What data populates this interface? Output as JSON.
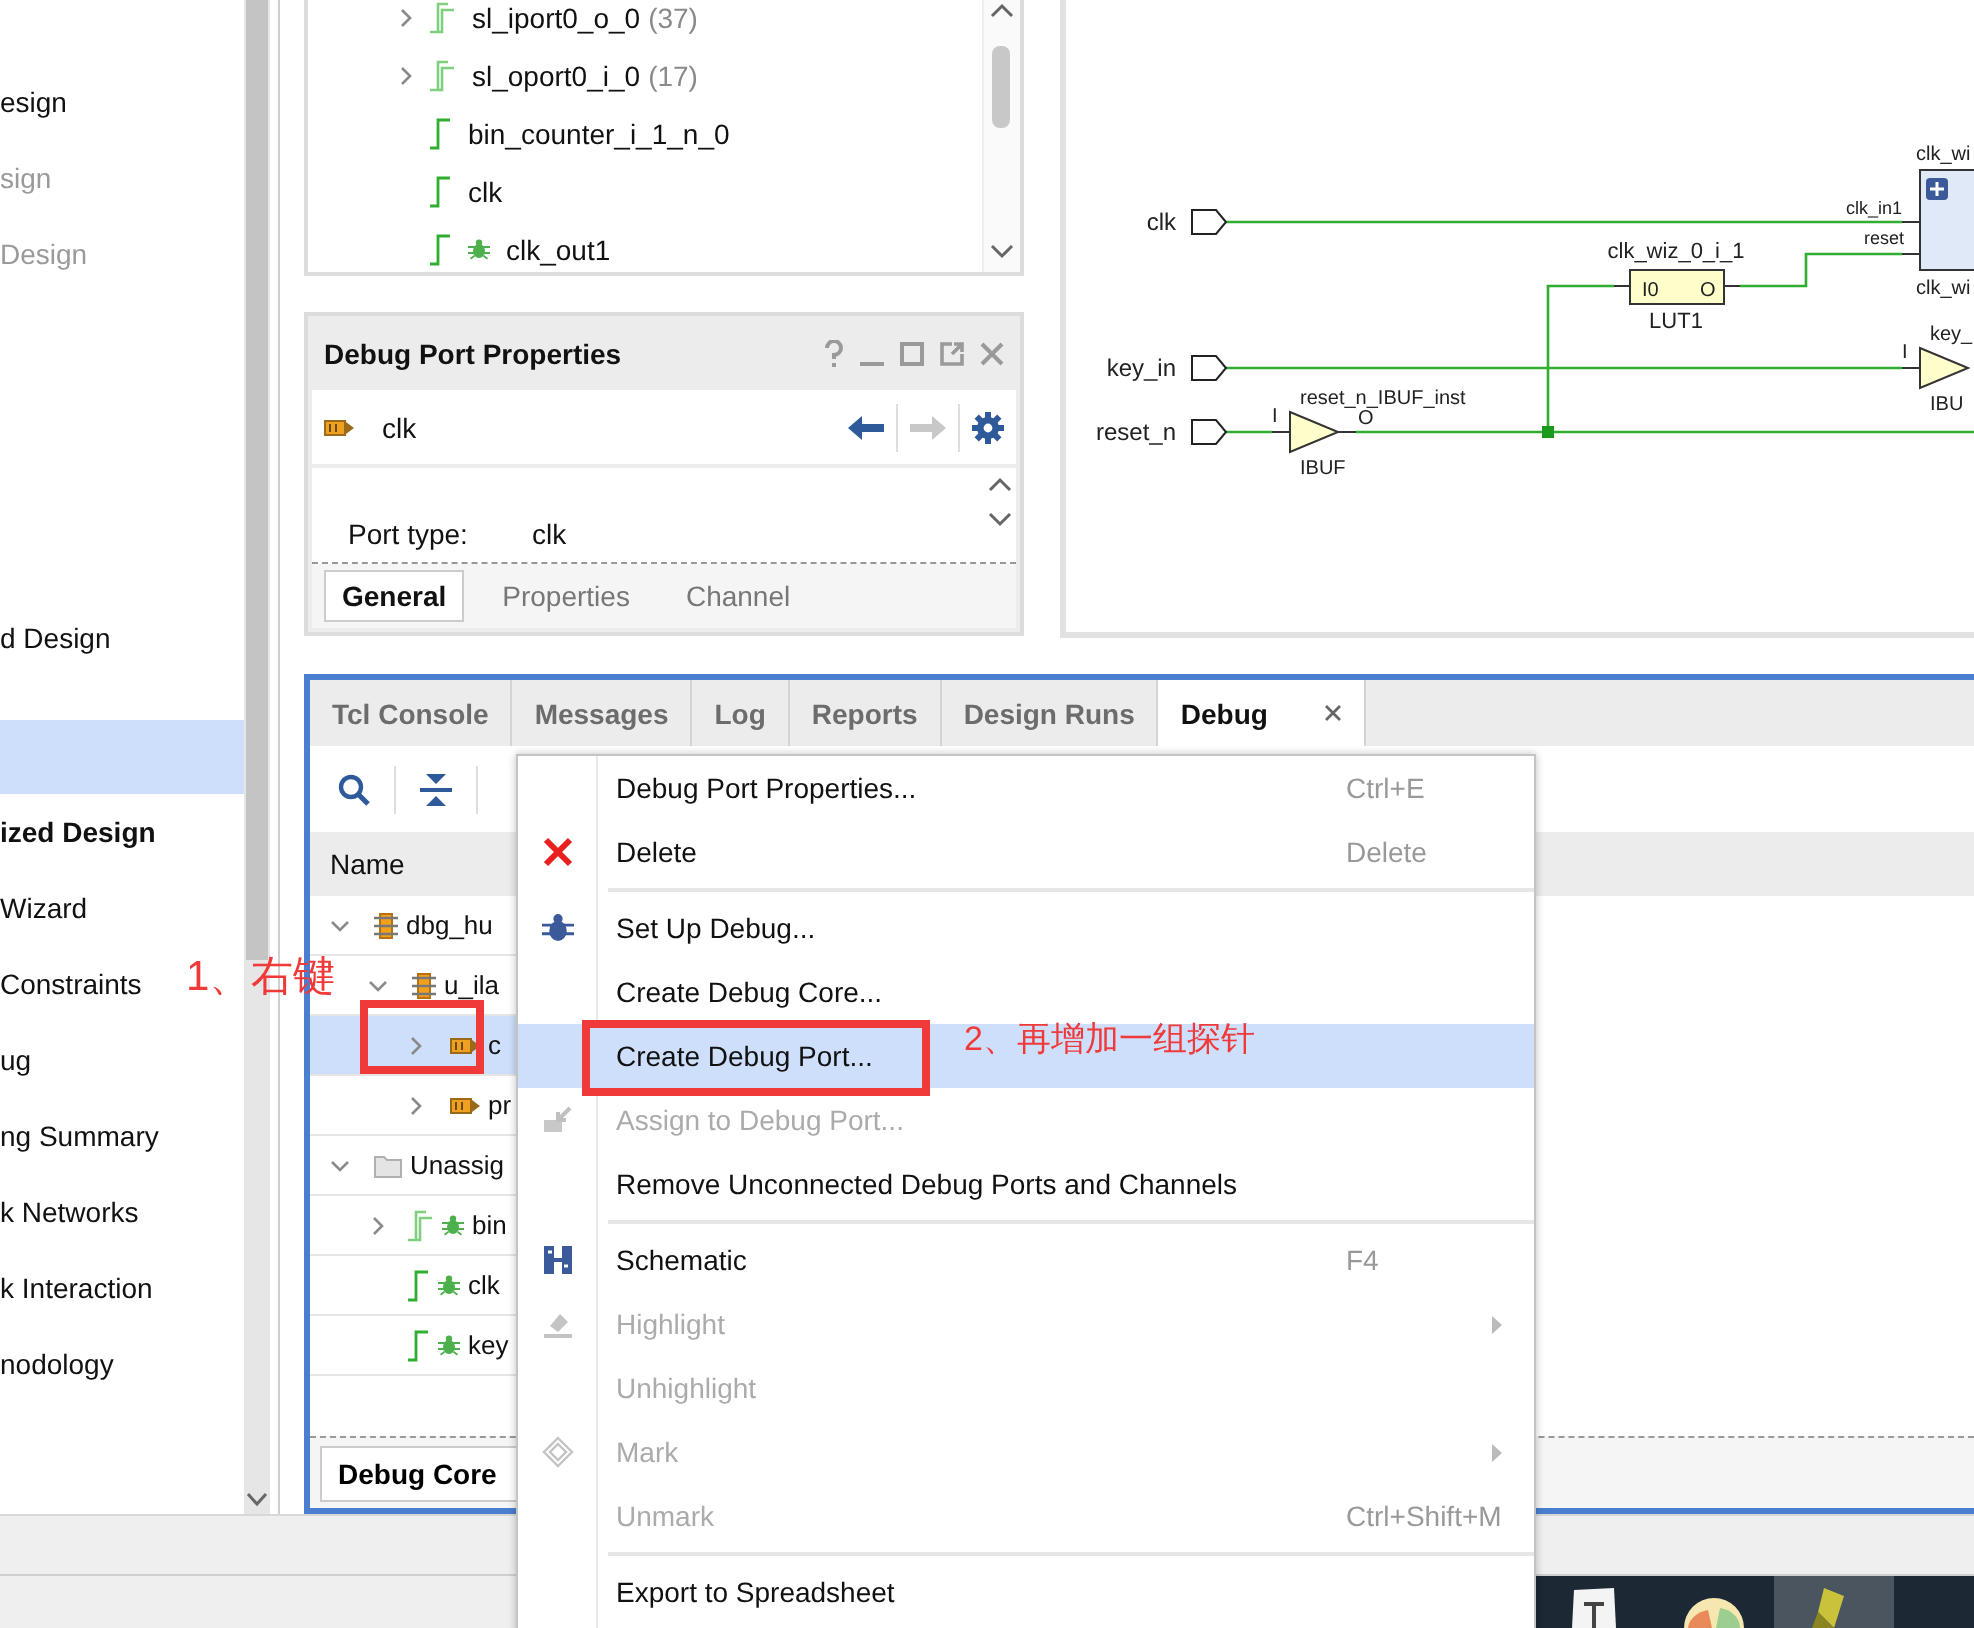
{
  "flow_navigator": {
    "sections": [
      {
        "items": [
          {
            "label": "esign",
            "disabled": false,
            "selected": false
          },
          {
            "label": "sign",
            "disabled": true,
            "selected": false
          },
          {
            "label": "Design",
            "disabled": true,
            "selected": false
          }
        ]
      },
      {
        "items": [
          {
            "label": "d Design",
            "disabled": false,
            "selected": false
          }
        ]
      },
      {
        "items": [
          {
            "selected": true
          }
        ]
      },
      {
        "heading": "ized Design",
        "items": [
          {
            "label": "Wizard",
            "disabled": false,
            "selected": false
          },
          {
            "label": "Constraints",
            "disabled": false,
            "selected": false
          },
          {
            "label": "ug",
            "disabled": false,
            "selected": false
          },
          {
            "label": "ng Summary",
            "disabled": false,
            "selected": false
          },
          {
            "label": "k Networks",
            "disabled": false,
            "selected": false
          },
          {
            "label": "k Interaction",
            "disabled": false,
            "selected": false
          },
          {
            "label": "nodology",
            "disabled": false,
            "selected": false
          }
        ]
      }
    ]
  },
  "netlist": {
    "rows": [
      {
        "name": "sl_iport0_o_0",
        "count": "(37)",
        "kind": "bus",
        "expanded": false,
        "selected": false
      },
      {
        "name": "sl_oport0_i_0",
        "count": "(17)",
        "kind": "bus",
        "expanded": false,
        "selected": false
      },
      {
        "name": "bin_counter_i_1_n_0",
        "kind": "net",
        "selected": false
      },
      {
        "name": "clk",
        "kind": "net",
        "selected": false
      },
      {
        "name": "clk_out1",
        "kind": "debug_net",
        "selected": false
      }
    ]
  },
  "properties": {
    "title": "Debug Port Properties",
    "object": "clk",
    "back_disabled": false,
    "forward_disabled": true,
    "fields": [
      {
        "label": "Port type:",
        "value": "clk"
      }
    ],
    "tabs": [
      {
        "label": "General",
        "selected": true
      },
      {
        "label": "Properties",
        "selected": false
      },
      {
        "label": "Channel",
        "selected": false
      }
    ]
  },
  "schematic": {
    "ports": [
      {
        "name": "clk"
      },
      {
        "name": "key_in"
      },
      {
        "name": "reset_n"
      }
    ],
    "cells": [
      {
        "kind": "buffer",
        "instance": "reset_n_IBUF_inst",
        "type": "IBUF",
        "pins": [
          "I",
          "O"
        ]
      },
      {
        "kind": "lut",
        "instance": "clk_wiz_0_i_1",
        "type": "LUT1",
        "pins": [
          "I0",
          "O"
        ]
      },
      {
        "kind": "block",
        "instance": "clk_wi",
        "type": "clk_wi",
        "pins": [
          "clk_in1",
          "reset"
        ]
      },
      {
        "kind": "buffer",
        "instance": "key_",
        "type": "IBU",
        "pins": [
          "I"
        ]
      }
    ]
  },
  "debug_window": {
    "tabs": [
      {
        "label": "Tcl Console",
        "selected": false
      },
      {
        "label": "Messages",
        "selected": false
      },
      {
        "label": "Log",
        "selected": false
      },
      {
        "label": "Reports",
        "selected": false
      },
      {
        "label": "Design Runs",
        "selected": false
      },
      {
        "label": "Debug",
        "selected": true
      }
    ],
    "columns": [
      "Name"
    ],
    "tree": [
      {
        "name": "dbg_hu",
        "kind": "core",
        "expanded": true,
        "selected": false,
        "children": [
          {
            "name": "u_ila",
            "kind": "core",
            "expanded": true,
            "selected": false,
            "children": [
              {
                "name": "c",
                "kind": "port",
                "expanded": false,
                "selected": true
              },
              {
                "name": "pr",
                "kind": "port",
                "expanded": false,
                "selected": false
              }
            ]
          }
        ]
      },
      {
        "name": "Unassig",
        "kind": "folder",
        "expanded": true,
        "selected": false,
        "children": [
          {
            "name": "bin",
            "kind": "debug_bus",
            "expanded": false,
            "selected": false
          },
          {
            "name": "clk",
            "kind": "debug_net",
            "selected": false
          },
          {
            "name": "key",
            "kind": "debug_net",
            "selected": false
          }
        ]
      }
    ],
    "bottom_tabs": [
      {
        "label": "Debug Core",
        "selected": true
      }
    ]
  },
  "context_menu": {
    "items": [
      {
        "kind": "item",
        "label": "Debug Port Properties...",
        "shortcut": "Ctrl+E",
        "disabled": false,
        "selected": false
      },
      {
        "kind": "item",
        "label": "Delete",
        "shortcut": "Delete",
        "disabled": false,
        "selected": false
      },
      {
        "kind": "separator"
      },
      {
        "kind": "item",
        "label": "Set Up Debug...",
        "disabled": false,
        "selected": false
      },
      {
        "kind": "item",
        "label": "Create Debug Core...",
        "disabled": false,
        "selected": false
      },
      {
        "kind": "item",
        "label": "Create Debug Port...",
        "disabled": false,
        "selected": true
      },
      {
        "kind": "item",
        "label": "Assign to Debug Port...",
        "disabled": true,
        "selected": false
      },
      {
        "kind": "item",
        "label": "Remove Unconnected Debug Ports and Channels",
        "disabled": false,
        "selected": false
      },
      {
        "kind": "separator"
      },
      {
        "kind": "item",
        "label": "Schematic",
        "shortcut": "F4",
        "disabled": false,
        "selected": false
      },
      {
        "kind": "item",
        "label": "Highlight",
        "submenu": true,
        "disabled": true,
        "selected": false
      },
      {
        "kind": "item",
        "label": "Unhighlight",
        "disabled": true,
        "selected": false
      },
      {
        "kind": "item",
        "label": "Mark",
        "submenu": true,
        "disabled": true,
        "selected": false
      },
      {
        "kind": "item",
        "label": "Unmark",
        "shortcut": "Ctrl+Shift+M",
        "disabled": true,
        "selected": false
      },
      {
        "kind": "separator"
      },
      {
        "kind": "item",
        "label": "Export to Spreadsheet",
        "disabled": false,
        "selected": false
      }
    ]
  },
  "annotations": [
    {
      "text": "1、右键"
    },
    {
      "text": "2、再增加一组探针"
    }
  ]
}
